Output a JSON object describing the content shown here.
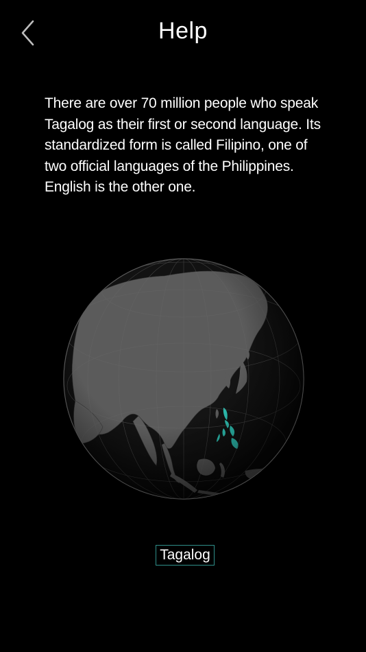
{
  "header": {
    "title": "Help",
    "back_icon": "chevron-left-icon"
  },
  "description": "There are over 70 million people who speak Tagalog as their first or second language. Its standardized form is called Filipino, one of two official languages of the Philippines. English is the other one.",
  "globe": {
    "highlight_region": "Philippines",
    "highlight_color": "#2ec4b6",
    "land_color": "#5a5a5a",
    "ocean_color": "#111111"
  },
  "language_button": {
    "label": "Tagalog",
    "border_color": "#2f8f8a"
  }
}
